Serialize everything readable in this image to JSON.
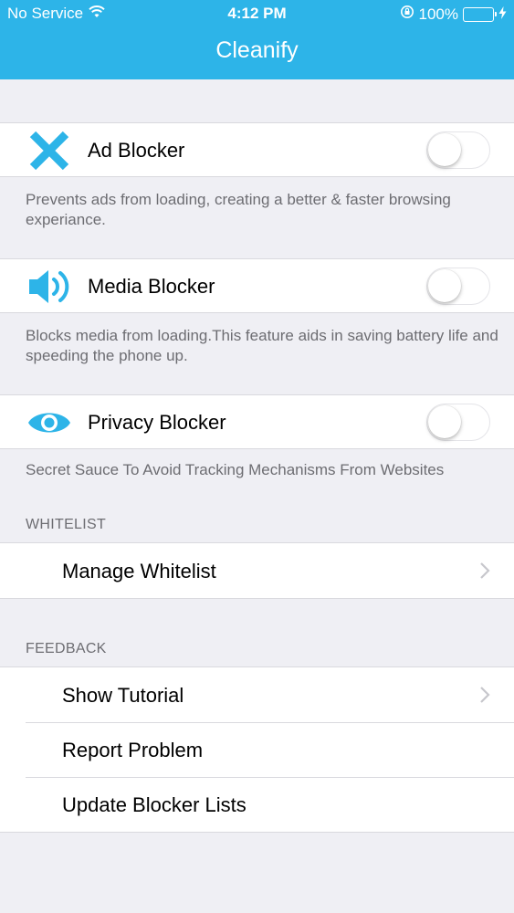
{
  "status_bar": {
    "carrier": "No Service",
    "time": "4:12 PM",
    "battery": "100%"
  },
  "nav": {
    "title": "Cleanify"
  },
  "blockers": [
    {
      "label": "Ad Blocker",
      "description": "Prevents ads from loading, creating a better & faster browsing experiance.",
      "enabled": false,
      "icon": "x-icon"
    },
    {
      "label": "Media Blocker",
      "description": "Blocks media from loading.This feature aids in saving battery life and speeding the phone up.",
      "enabled": false,
      "icon": "speaker-icon"
    },
    {
      "label": "Privacy Blocker",
      "description": "Secret Sauce To Avoid Tracking Mechanisms From Websites",
      "enabled": false,
      "icon": "eye-icon"
    }
  ],
  "whitelist": {
    "header": "WHITELIST",
    "items": [
      {
        "label": "Manage Whitelist"
      }
    ]
  },
  "feedback": {
    "header": "FEEDBACK",
    "items": [
      {
        "label": "Show Tutorial"
      },
      {
        "label": "Report Problem"
      },
      {
        "label": "Update Blocker Lists"
      }
    ]
  },
  "colors": {
    "accent": "#2db4e8",
    "background": "#efeff4",
    "battery": "#4cd964"
  }
}
